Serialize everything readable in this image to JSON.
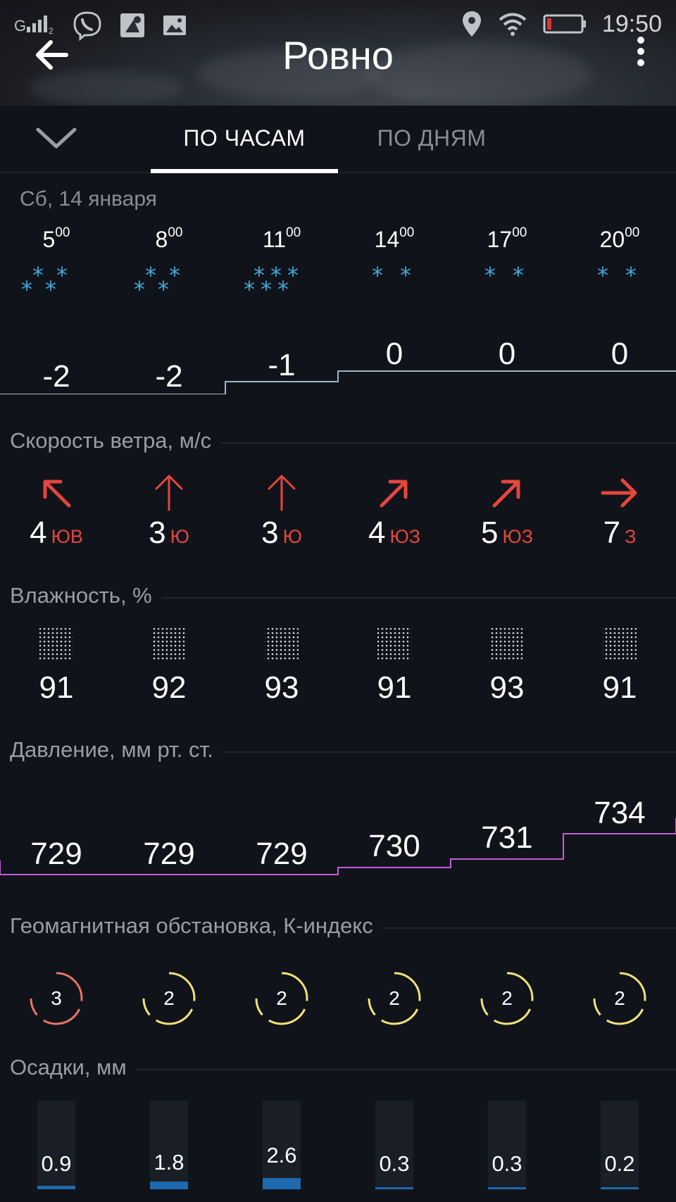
{
  "status_bar": {
    "time": "19:50",
    "icons": [
      "signal-icon",
      "viber-icon",
      "maps-icon",
      "gallery-icon",
      "location-icon",
      "wifi-icon",
      "battery-icon"
    ]
  },
  "header": {
    "city": "Ровно"
  },
  "tabs": [
    {
      "label": "ПО ЧАСАМ",
      "active": true
    },
    {
      "label": "ПО ДНЯМ",
      "active": false
    }
  ],
  "date": "Сб, 14 января",
  "hours": [
    {
      "h": "5",
      "m": "00"
    },
    {
      "h": "8",
      "m": "00"
    },
    {
      "h": "11",
      "m": "00"
    },
    {
      "h": "14",
      "m": "00"
    },
    {
      "h": "17",
      "m": "00"
    },
    {
      "h": "20",
      "m": "00"
    }
  ],
  "weather_icons": [
    "snow-icon",
    "snow-icon",
    "heavy-snow-icon",
    "light-snow-icon",
    "light-snow-icon",
    "light-snow-icon"
  ],
  "temperature": [
    "-2",
    "-2",
    "-1",
    "0",
    "0",
    "0"
  ],
  "wind": {
    "title": "Скорость ветра, м/с",
    "items": [
      {
        "speed": "4",
        "dir": "ЮВ",
        "arrow": "up-left-arrow-icon"
      },
      {
        "speed": "3",
        "dir": "Ю",
        "arrow": "up-arrow-icon"
      },
      {
        "speed": "3",
        "dir": "Ю",
        "arrow": "up-arrow-icon"
      },
      {
        "speed": "4",
        "dir": "ЮЗ",
        "arrow": "up-right-arrow-icon"
      },
      {
        "speed": "5",
        "dir": "ЮЗ",
        "arrow": "up-right-arrow-icon"
      },
      {
        "speed": "7",
        "dir": "З",
        "arrow": "right-arrow-icon"
      }
    ]
  },
  "humidity": {
    "title": "Влажность, %",
    "values": [
      "91",
      "92",
      "93",
      "91",
      "93",
      "91"
    ]
  },
  "pressure": {
    "title": "Давление, мм рт. ст.",
    "values": [
      "729",
      "729",
      "729",
      "730",
      "731",
      "734"
    ]
  },
  "geomagnetic": {
    "title": "Геомагнитная обстановка, К-индекс",
    "values": [
      "3",
      "2",
      "2",
      "2",
      "2",
      "2"
    ]
  },
  "precipitation": {
    "title": "Осадки, мм",
    "values": [
      "0.9",
      "1.8",
      "2.6",
      "0.3",
      "0.3",
      "0.2"
    ]
  },
  "colors": {
    "background": "#11131a",
    "snow": "#3fa7d6",
    "wind_arrow": "#e5463d",
    "temp_line": "#9fb8cc",
    "pressure_line": "#c75bd8",
    "k_index_3": "#e8746b",
    "k_index_2": "#f2e27a",
    "precip": "#1e6aae"
  }
}
